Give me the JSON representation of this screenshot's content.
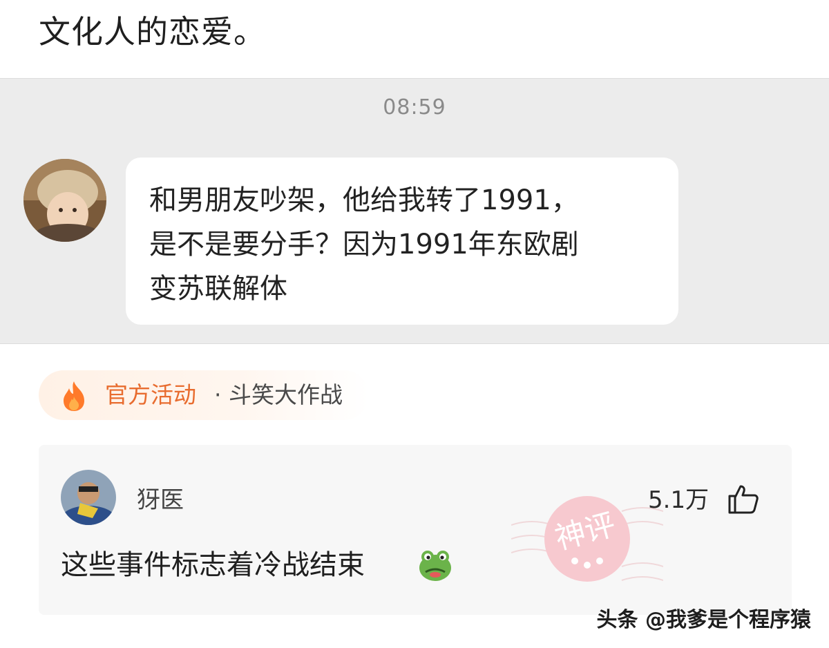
{
  "post": {
    "title": "文化人的恋爱。"
  },
  "chat": {
    "time": "08:59",
    "message_lines": [
      "和男朋友吵架，他给我转了1991，",
      "是不是要分手？因为1991年东欧剧",
      "变苏联解体"
    ]
  },
  "activity": {
    "label": "官方活动",
    "separator": " · ",
    "name": "斗笑大作战",
    "icon": "fire-icon",
    "accent_color": "#e86c2f"
  },
  "comment": {
    "username": "犽医",
    "likes": "5.1万",
    "text": "这些事件标志着冷战结束",
    "emoji": "frog-face-icon",
    "stamp_text": "神评"
  },
  "watermark": "头条 @我爹是个程序猿"
}
